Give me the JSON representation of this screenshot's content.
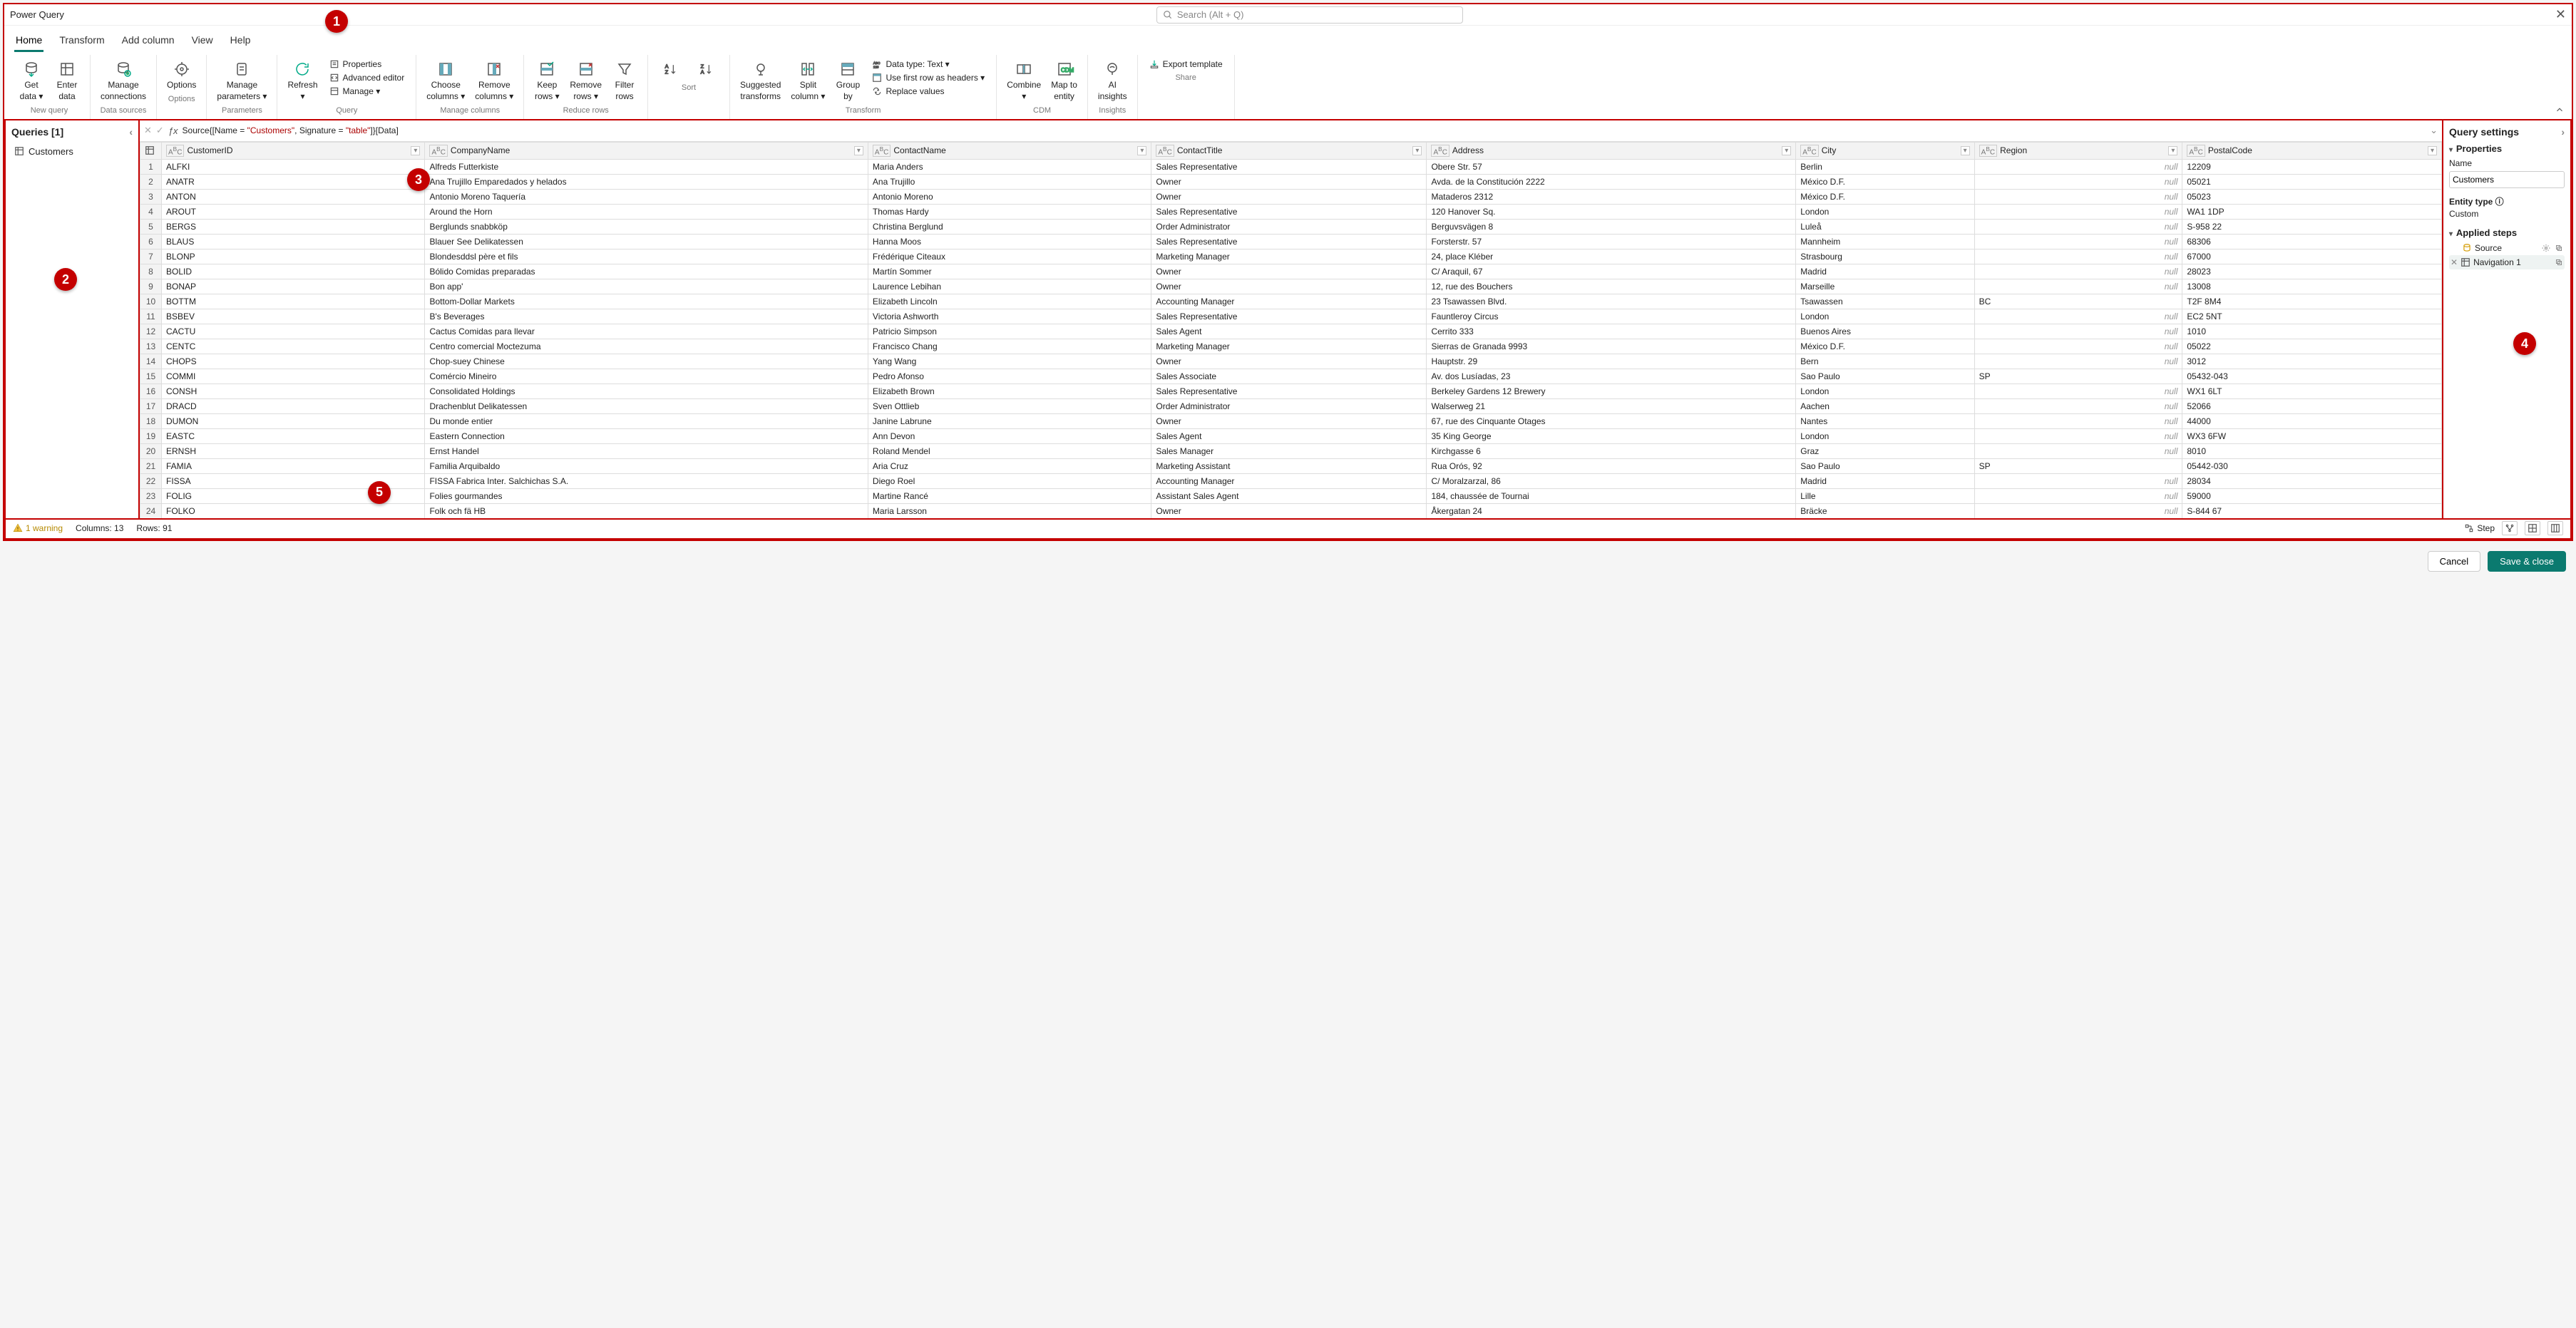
{
  "window": {
    "title": "Power Query",
    "search_placeholder": "Search (Alt + Q)"
  },
  "tabs": [
    "Home",
    "Transform",
    "Add column",
    "View",
    "Help"
  ],
  "ribbon": {
    "groups": [
      {
        "label": "New query",
        "items": [
          {
            "id": "get-data",
            "label": "Get\ndata ▾"
          },
          {
            "id": "enter-data",
            "label": "Enter\ndata"
          }
        ]
      },
      {
        "label": "Data sources",
        "items": [
          {
            "id": "manage-connections",
            "label": "Manage\nconnections"
          }
        ]
      },
      {
        "label": "Options",
        "items": [
          {
            "id": "options",
            "label": "Options"
          }
        ]
      },
      {
        "label": "Parameters",
        "items": [
          {
            "id": "manage-parameters",
            "label": "Manage\nparameters ▾"
          }
        ]
      },
      {
        "label": "Query",
        "items": [
          {
            "id": "refresh",
            "label": "Refresh\n▾"
          }
        ],
        "stack": [
          {
            "id": "properties",
            "label": "Properties"
          },
          {
            "id": "advanced-editor",
            "label": "Advanced editor"
          },
          {
            "id": "manage",
            "label": "Manage ▾"
          }
        ]
      },
      {
        "label": "Manage columns",
        "items": [
          {
            "id": "choose-columns",
            "label": "Choose\ncolumns ▾"
          },
          {
            "id": "remove-columns",
            "label": "Remove\ncolumns ▾"
          }
        ]
      },
      {
        "label": "Reduce rows",
        "items": [
          {
            "id": "keep-rows",
            "label": "Keep\nrows ▾"
          },
          {
            "id": "remove-rows",
            "label": "Remove\nrows ▾"
          },
          {
            "id": "filter-rows",
            "label": "Filter\nrows"
          }
        ]
      },
      {
        "label": "Sort",
        "items": [
          {
            "id": "sort-asc",
            "label": ""
          },
          {
            "id": "sort-desc",
            "label": ""
          }
        ]
      },
      {
        "label": "Transform",
        "items": [
          {
            "id": "suggested-transforms",
            "label": "Suggested\ntransforms"
          },
          {
            "id": "split-column",
            "label": "Split\ncolumn ▾"
          },
          {
            "id": "group-by",
            "label": "Group\nby"
          }
        ],
        "stack": [
          {
            "id": "data-type",
            "label": "Data type: Text ▾"
          },
          {
            "id": "first-row-headers",
            "label": "Use first row as headers ▾"
          },
          {
            "id": "replace-values",
            "label": "Replace values"
          }
        ]
      },
      {
        "label": "CDM",
        "items": [
          {
            "id": "combine",
            "label": "Combine\n▾"
          },
          {
            "id": "map-to-entity",
            "label": "Map to\nentity"
          }
        ]
      },
      {
        "label": "Insights",
        "items": [
          {
            "id": "ai-insights",
            "label": "AI\ninsights"
          }
        ]
      },
      {
        "label": "Share",
        "items": [],
        "stack": [
          {
            "id": "export-template",
            "label": "Export template"
          }
        ]
      }
    ]
  },
  "queries": {
    "title": "Queries [1]",
    "items": [
      "Customers"
    ]
  },
  "formula": {
    "prefix": "Source{[Name = ",
    "arg1": "\"Customers\"",
    "mid": ", Signature = ",
    "arg2": "\"table\"",
    "suffix": "]}[Data]"
  },
  "columns": [
    "CustomerID",
    "CompanyName",
    "ContactName",
    "ContactTitle",
    "Address",
    "City",
    "Region",
    "PostalCode"
  ],
  "rows": [
    [
      "ALFKI",
      "Alfreds Futterkiste",
      "Maria Anders",
      "Sales Representative",
      "Obere Str. 57",
      "Berlin",
      null,
      "12209"
    ],
    [
      "ANATR",
      "Ana Trujillo Emparedados y helados",
      "Ana Trujillo",
      "Owner",
      "Avda. de la Constitución 2222",
      "México D.F.",
      null,
      "05021"
    ],
    [
      "ANTON",
      "Antonio Moreno Taquería",
      "Antonio Moreno",
      "Owner",
      "Mataderos  2312",
      "México D.F.",
      null,
      "05023"
    ],
    [
      "AROUT",
      "Around the Horn",
      "Thomas Hardy",
      "Sales Representative",
      "120 Hanover Sq.",
      "London",
      null,
      "WA1 1DP"
    ],
    [
      "BERGS",
      "Berglunds snabbköp",
      "Christina Berglund",
      "Order Administrator",
      "Berguvsvägen  8",
      "Luleå",
      null,
      "S-958 22"
    ],
    [
      "BLAUS",
      "Blauer See Delikatessen",
      "Hanna Moos",
      "Sales Representative",
      "Forsterstr. 57",
      "Mannheim",
      null,
      "68306"
    ],
    [
      "BLONP",
      "Blondesddsl père et fils",
      "Frédérique Citeaux",
      "Marketing Manager",
      "24, place Kléber",
      "Strasbourg",
      null,
      "67000"
    ],
    [
      "BOLID",
      "Bólido Comidas preparadas",
      "Martín Sommer",
      "Owner",
      "C/ Araquil, 67",
      "Madrid",
      null,
      "28023"
    ],
    [
      "BONAP",
      "Bon app'",
      "Laurence Lebihan",
      "Owner",
      "12, rue des Bouchers",
      "Marseille",
      null,
      "13008"
    ],
    [
      "BOTTM",
      "Bottom-Dollar Markets",
      "Elizabeth Lincoln",
      "Accounting Manager",
      "23 Tsawassen Blvd.",
      "Tsawassen",
      "BC",
      "T2F 8M4"
    ],
    [
      "BSBEV",
      "B's Beverages",
      "Victoria Ashworth",
      "Sales Representative",
      "Fauntleroy Circus",
      "London",
      null,
      "EC2 5NT"
    ],
    [
      "CACTU",
      "Cactus Comidas para llevar",
      "Patricio Simpson",
      "Sales Agent",
      "Cerrito 333",
      "Buenos Aires",
      null,
      "1010"
    ],
    [
      "CENTC",
      "Centro comercial Moctezuma",
      "Francisco Chang",
      "Marketing Manager",
      "Sierras de Granada 9993",
      "México D.F.",
      null,
      "05022"
    ],
    [
      "CHOPS",
      "Chop-suey Chinese",
      "Yang Wang",
      "Owner",
      "Hauptstr. 29",
      "Bern",
      null,
      "3012"
    ],
    [
      "COMMI",
      "Comércio Mineiro",
      "Pedro Afonso",
      "Sales Associate",
      "Av. dos Lusíadas, 23",
      "Sao Paulo",
      "SP",
      "05432-043"
    ],
    [
      "CONSH",
      "Consolidated Holdings",
      "Elizabeth Brown",
      "Sales Representative",
      "Berkeley Gardens 12  Brewery",
      "London",
      null,
      "WX1 6LT"
    ],
    [
      "DRACD",
      "Drachenblut Delikatessen",
      "Sven Ottlieb",
      "Order Administrator",
      "Walserweg 21",
      "Aachen",
      null,
      "52066"
    ],
    [
      "DUMON",
      "Du monde entier",
      "Janine Labrune",
      "Owner",
      "67, rue des Cinquante Otages",
      "Nantes",
      null,
      "44000"
    ],
    [
      "EASTC",
      "Eastern Connection",
      "Ann Devon",
      "Sales Agent",
      "35 King George",
      "London",
      null,
      "WX3 6FW"
    ],
    [
      "ERNSH",
      "Ernst Handel",
      "Roland Mendel",
      "Sales Manager",
      "Kirchgasse 6",
      "Graz",
      null,
      "8010"
    ],
    [
      "FAMIA",
      "Familia Arquibaldo",
      "Aria Cruz",
      "Marketing Assistant",
      "Rua Orós, 92",
      "Sao Paulo",
      "SP",
      "05442-030"
    ],
    [
      "FISSA",
      "FISSA Fabrica Inter. Salchichas S.A.",
      "Diego Roel",
      "Accounting Manager",
      "C/ Moralzarzal, 86",
      "Madrid",
      null,
      "28034"
    ],
    [
      "FOLIG",
      "Folies gourmandes",
      "Martine Rancé",
      "Assistant Sales Agent",
      "184, chaussée de Tournai",
      "Lille",
      null,
      "59000"
    ],
    [
      "FOLKO",
      "Folk och fä HB",
      "Maria Larsson",
      "Owner",
      "Åkergatan 24",
      "Bräcke",
      null,
      "S-844 67"
    ]
  ],
  "settings": {
    "title": "Query settings",
    "properties_label": "Properties",
    "name_label": "Name",
    "name_value": "Customers",
    "entity_type_label": "Entity type ⓘ",
    "entity_type_value": "Custom",
    "applied_steps_label": "Applied steps",
    "steps": [
      {
        "name": "Source",
        "icon": "db",
        "gear": true
      },
      {
        "name": "Navigation 1",
        "icon": "table",
        "del": true,
        "selected": true
      }
    ]
  },
  "status": {
    "warning": "1 warning",
    "columns": "Columns: 13",
    "rows": "Rows: 91",
    "step_label": "Step"
  },
  "footer": {
    "cancel": "Cancel",
    "save": "Save & close"
  },
  "callouts": [
    "1",
    "2",
    "3",
    "4",
    "5"
  ]
}
